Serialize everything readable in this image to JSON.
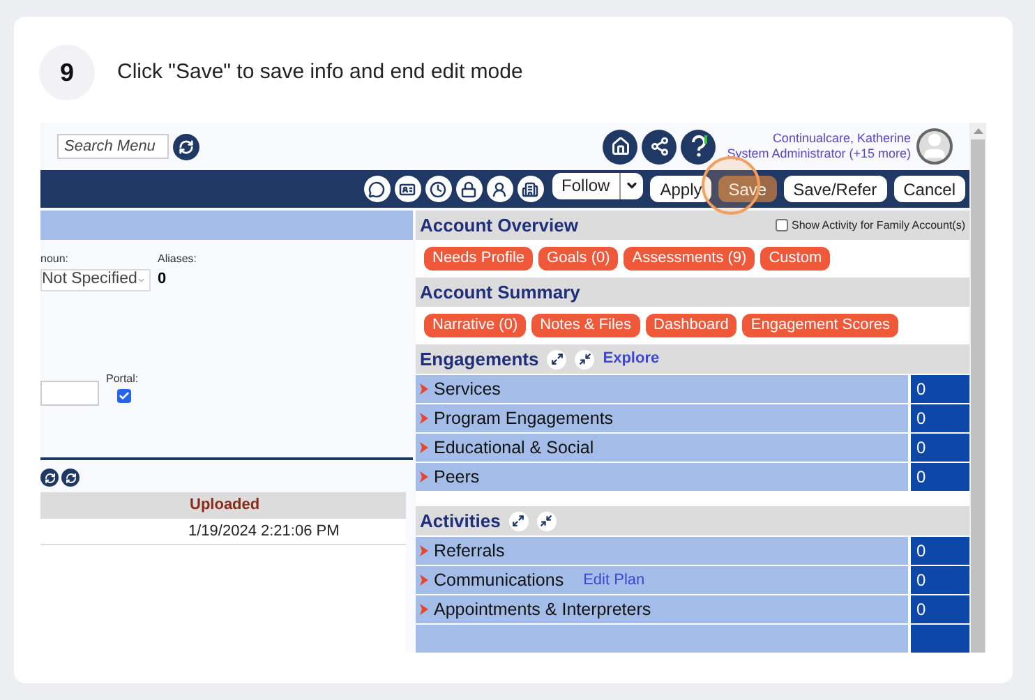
{
  "step": {
    "number": "9",
    "instruction": "Click \"Save\" to save info and end edit mode"
  },
  "top_bar": {
    "search": {
      "placeholder": "Search Menu"
    },
    "user": {
      "name": "Continualcare, Katherine",
      "role": "System Administrator (+15 more)"
    }
  },
  "toolbar": {
    "buttons": [
      {
        "label": "Follow",
        "kind": "split",
        "highlighted": false
      },
      {
        "label": "Apply",
        "kind": "plain",
        "highlighted": false
      },
      {
        "label": "Save",
        "kind": "plain",
        "highlighted": true
      },
      {
        "label": "Save/Refer",
        "kind": "plain",
        "highlighted": false
      },
      {
        "label": "Cancel",
        "kind": "plain",
        "highlighted": false
      }
    ]
  },
  "left_panel": {
    "pronoun": {
      "label": "noun:",
      "value": "Not Specified"
    },
    "aliases": {
      "label": "Aliases:",
      "value": "0"
    },
    "portal": {
      "label": "Portal:",
      "checked": true
    },
    "documents_table": {
      "columns": [
        "Uploaded"
      ],
      "rows": [
        [
          "1/19/2024 2:21:06 PM"
        ]
      ]
    }
  },
  "right_panel": {
    "account_overview": {
      "title": "Account Overview",
      "family_checkbox": {
        "label": "Show Activity for Family Account(s)",
        "checked": false
      },
      "pills": [
        "Needs Profile",
        "Goals (0)",
        "Assessments (9)",
        "Custom"
      ]
    },
    "account_summary": {
      "title": "Account Summary",
      "pills": [
        "Narrative (0)",
        "Notes & Files",
        "Dashboard",
        "Engagement Scores"
      ]
    },
    "engagements": {
      "title": "Engagements",
      "link": "Explore",
      "rows": [
        {
          "label": "Services",
          "count": "0"
        },
        {
          "label": "Program Engagements",
          "count": "0"
        },
        {
          "label": "Educational & Social",
          "count": "0"
        },
        {
          "label": "Peers",
          "count": "0"
        }
      ]
    },
    "activities": {
      "title": "Activities",
      "rows": [
        {
          "label": "Referrals",
          "count": "0"
        },
        {
          "label": "Communications",
          "link": "Edit Plan",
          "count": "0"
        },
        {
          "label": "Appointments & Interpreters",
          "count": "0"
        }
      ]
    }
  }
}
